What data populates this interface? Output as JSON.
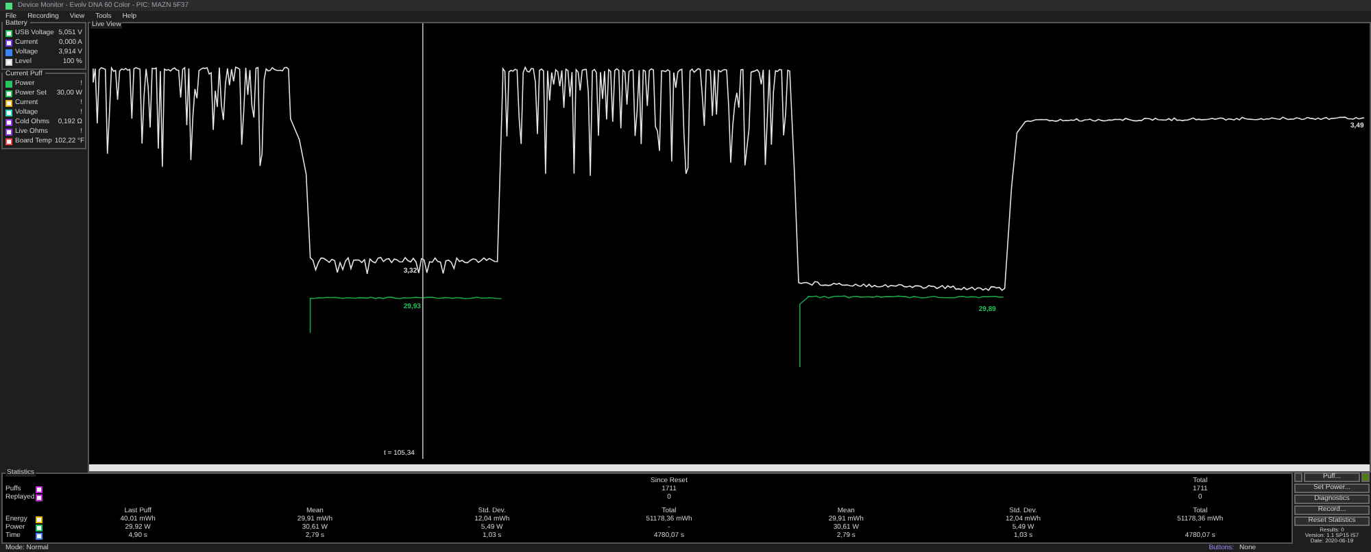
{
  "window": {
    "title": "Device Monitor - Evolv DNA 60 Color - PIC: MAZN 5F37"
  },
  "menu": [
    "File",
    "Recording",
    "View",
    "Tools",
    "Help"
  ],
  "battery": {
    "title": "Battery",
    "items": [
      {
        "label": "USB Voltage",
        "value": "5,051 V",
        "color": "#22c55e",
        "checked": false
      },
      {
        "label": "Current",
        "value": "0,000 A",
        "color": "#7c3aed",
        "checked": false
      },
      {
        "label": "Voltage",
        "value": "3,914 V",
        "color": "#3b82f6",
        "checked": true
      },
      {
        "label": "Level",
        "value": "100 %",
        "color": "#d1d5db",
        "checked": false
      }
    ]
  },
  "current_puff": {
    "title": "Current Puff",
    "items": [
      {
        "label": "Power",
        "value": "!",
        "color": "#22c55e",
        "checked": true
      },
      {
        "label": "Power Set",
        "value": "30,00 W",
        "color": "#22c55e",
        "checked": false
      },
      {
        "label": "Current",
        "value": "!",
        "color": "#eab308",
        "checked": false
      },
      {
        "label": "Voltage",
        "value": "!",
        "color": "#2dd4bf",
        "checked": false
      },
      {
        "label": "Cold Ohms",
        "value": "0,192 Ω",
        "color": "#9333ea",
        "checked": false
      },
      {
        "label": "Live Ohms",
        "value": "!",
        "color": "#9333ea",
        "checked": false
      },
      {
        "label": "Board Temp",
        "value": "102,22 °F",
        "color": "#ef4444",
        "checked": false
      }
    ]
  },
  "live_view": {
    "title": "Live View",
    "labels": [
      {
        "kind": "white",
        "text": "3,32"
      },
      {
        "kind": "green",
        "text": "29,93"
      },
      {
        "kind": "green",
        "text": "29,89"
      },
      {
        "kind": "white",
        "text": "3,49"
      }
    ],
    "cursor": "t = 105,34"
  },
  "statistics": {
    "title": "Statistics",
    "groups": [
      {
        "title": "Since Reset",
        "puffs": "1711",
        "replayed": "0"
      },
      {
        "title": "Total",
        "puffs": "1711",
        "replayed": "0"
      }
    ],
    "counters": [
      {
        "label": "Puffs",
        "color": "#c026d3"
      },
      {
        "label": "Replayed",
        "color": "#c026d3"
      }
    ],
    "columns": [
      "Last Puff",
      "Mean",
      "Std. Dev.",
      "Total",
      "Mean",
      "Std. Dev.",
      "Total"
    ],
    "rows": [
      {
        "label": "Energy",
        "color": "#eab308",
        "cells": [
          "40,01 mWh",
          "29,91 mWh",
          "12,04 mWh",
          "51178,36 mWh",
          "29,91 mWh",
          "12,04 mWh",
          "51178,36 mWh"
        ]
      },
      {
        "label": "Power",
        "color": "#22c55e",
        "cells": [
          "29,92 W",
          "30,61 W",
          "5,49 W",
          "-",
          "30,61 W",
          "5,49 W",
          "-"
        ]
      },
      {
        "label": "Time",
        "color": "#3b82f6",
        "cells": [
          "4,90 s",
          "2,79 s",
          "1,03 s",
          "4780,07 s",
          "2,79 s",
          "1,03 s",
          "4780,07 s"
        ]
      }
    ]
  },
  "buttons": [
    "Puff...",
    "Set Power...",
    "Diagnostics",
    "Record...",
    "Reset Statistics"
  ],
  "info": [
    "Results: 0",
    "Version: 1.1 SP15 IS7",
    "Date: 2020-06-19"
  ],
  "status_bar": {
    "mode": "Mode: Normal",
    "buttons_label": "Buttons:",
    "buttons_value": "None"
  }
}
